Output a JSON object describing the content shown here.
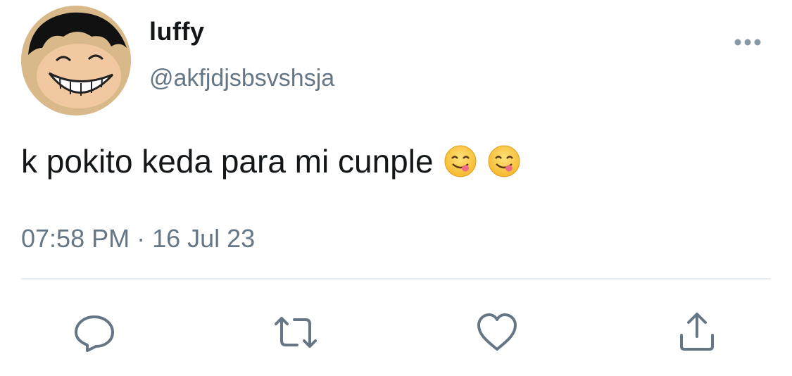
{
  "tweet": {
    "author": {
      "display_name": "luffy",
      "handle": "@akfjdjsbsvshsja",
      "avatar_icon": "avatar-luffy"
    },
    "text": "k pokito keda para mi cunple",
    "emojis": [
      "face-savoring-food",
      "face-savoring-food"
    ],
    "timestamp": "07:58 PM · 16 Jul 23"
  },
  "actions": {
    "reply_icon": "reply-icon",
    "retweet_icon": "retweet-icon",
    "like_icon": "heart-icon",
    "share_icon": "share-icon",
    "more_icon": "more-icon"
  },
  "colors": {
    "text_primary": "#14171a",
    "text_secondary": "#657786",
    "icon_gray": "#657786",
    "divider": "#e6ecf0"
  }
}
